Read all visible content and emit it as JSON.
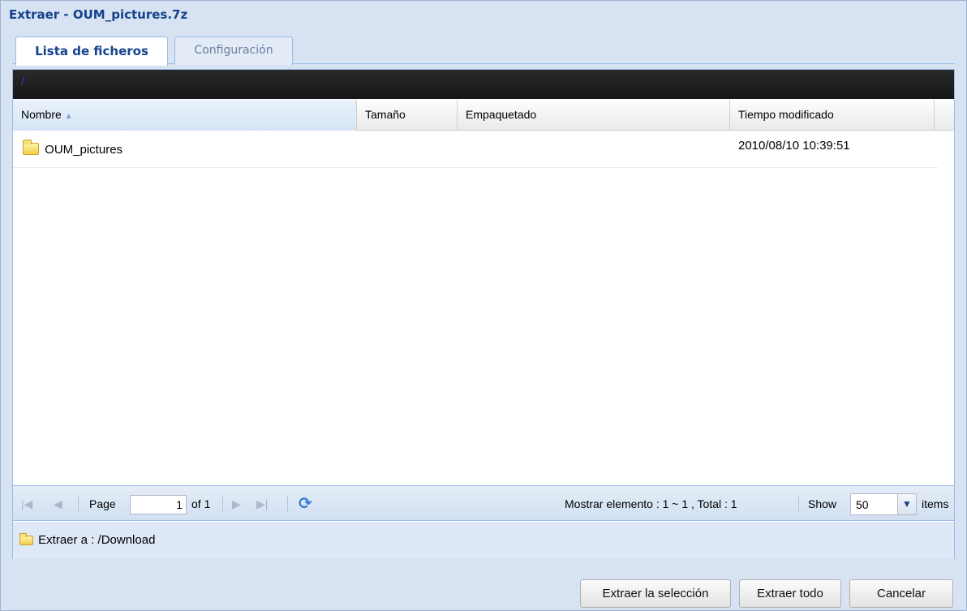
{
  "window": {
    "title": "Extraer - OUM_pictures.7z"
  },
  "tabs": [
    {
      "label": "Lista de ficheros",
      "active": true
    },
    {
      "label": "Configuración",
      "active": false
    }
  ],
  "path": "/",
  "grid": {
    "columns": [
      "Nombre",
      "Tamaño",
      "Empaquetado",
      "Tiempo modificado"
    ],
    "sort_column": "Nombre",
    "sort_direction": "ascending",
    "rows": [
      {
        "icon": "folder-icon",
        "name": "OUM_pictures",
        "size": "",
        "packed": "",
        "modified": "2010/08/10 10:39:51"
      }
    ]
  },
  "pager": {
    "page_label": "Page",
    "page_value": "1",
    "of_label": "of 1",
    "summary": "Mostrar elemento : 1 ~ 1 , Total : 1",
    "show_label": "Show",
    "show_value": "50",
    "items_label": "items"
  },
  "extract_to": {
    "label": "Extraer a : /Download"
  },
  "buttons": {
    "extract_selection": "Extraer la selección",
    "extract_all": "Extraer todo",
    "cancel": "Cancelar"
  },
  "colors": {
    "title": "#15428b",
    "window_bg": "#d7e3f2",
    "path_bar": "#1b1b1b",
    "border": "#99bbe8"
  }
}
